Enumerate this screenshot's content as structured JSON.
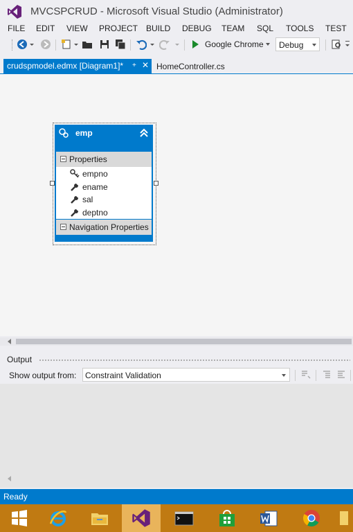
{
  "window": {
    "title": "MVCSPCRUD - Microsoft Visual Studio (Administrator)"
  },
  "menu": {
    "items": [
      "FILE",
      "EDIT",
      "VIEW",
      "PROJECT",
      "BUILD",
      "DEBUG",
      "TEAM",
      "SQL",
      "TOOLS",
      "TEST"
    ]
  },
  "toolbar": {
    "run_target": "Google Chrome",
    "configuration": "Debug"
  },
  "tabs": [
    {
      "label": "crudspmodel.edmx [Diagram1]*",
      "active": true
    },
    {
      "label": "HomeController.cs",
      "active": false
    }
  ],
  "entity": {
    "name": "emp",
    "properties_header": "Properties",
    "properties": [
      {
        "name": "empno",
        "icon": "key-icon"
      },
      {
        "name": "ename",
        "icon": "wrench-icon"
      },
      {
        "name": "sal",
        "icon": "wrench-icon"
      },
      {
        "name": "deptno",
        "icon": "wrench-icon"
      }
    ],
    "navigation_header": "Navigation Properties"
  },
  "output": {
    "title": "Output",
    "show_from_label": "Show output from:",
    "source": "Constraint Validation"
  },
  "status": {
    "text": "Ready"
  },
  "colors": {
    "accent": "#007acc",
    "taskbar": "#c07a12"
  },
  "taskbar": {
    "apps": [
      "windows-start-icon",
      "internet-explorer-icon",
      "file-explorer-icon",
      "visual-studio-icon",
      "command-prompt-icon",
      "windows-store-icon",
      "word-icon",
      "chrome-icon"
    ]
  }
}
